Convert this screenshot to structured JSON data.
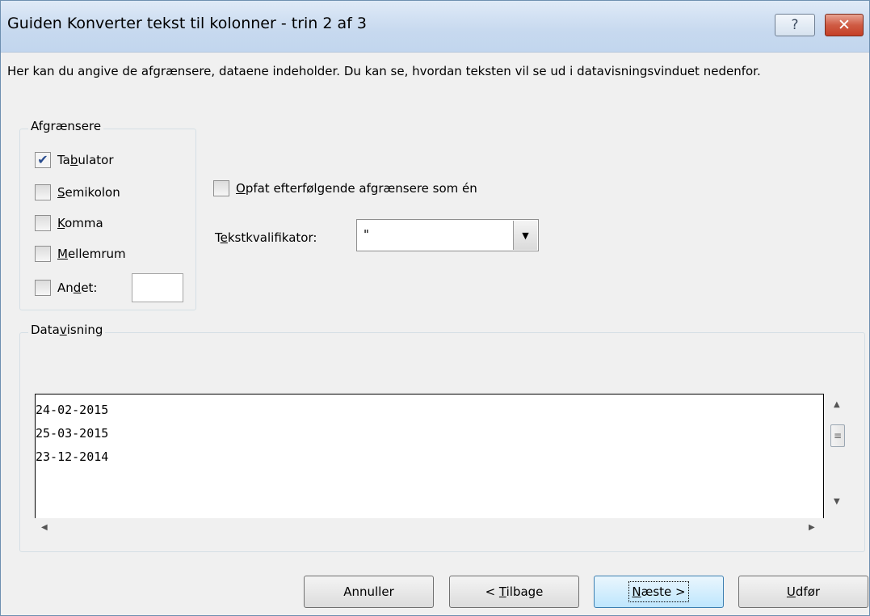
{
  "window": {
    "title": "Guiden Konverter tekst til kolonner - trin 2 af 3",
    "help_glyph": "?",
    "close_glyph": "✕"
  },
  "intro_text": "Her kan du angive de afgrænsere, dataene indeholder. Du kan se, hvordan teksten vil se ud i datavisningsvinduet nedenfor.",
  "delimiters": {
    "legend": "Afgrænsere",
    "tab": {
      "pre": "Ta",
      "key": "b",
      "post": "ulator",
      "checked": true
    },
    "semicolon": {
      "pre": "",
      "key": "S",
      "post": "emikolon",
      "checked": false
    },
    "comma": {
      "pre": "",
      "key": "K",
      "post": "omma",
      "checked": false
    },
    "space": {
      "pre": "",
      "key": "M",
      "post": "ellemrum",
      "checked": false
    },
    "other": {
      "pre": "An",
      "key": "d",
      "post": "et:",
      "checked": false,
      "value": ""
    }
  },
  "consecutive": {
    "pre": "",
    "key": "O",
    "post": "pfat efterfølgende afgrænsere som én",
    "checked": false
  },
  "qualifier": {
    "pre": "T",
    "key": "e",
    "post": "kstkvalifikator:",
    "value": "\""
  },
  "preview": {
    "legend_pre": "Data",
    "legend_key": "v",
    "legend_post": "isning",
    "lines": [
      "24-02-2015",
      "25-03-2015",
      "23-12-2014"
    ]
  },
  "buttons": {
    "cancel": {
      "label": "Annuller"
    },
    "back": {
      "pre": "< ",
      "key": "T",
      "post": "ilbage"
    },
    "next": {
      "pre": "",
      "key": "N",
      "post": "æste >"
    },
    "finish": {
      "pre": "",
      "key": "U",
      "post": "dfør"
    }
  }
}
